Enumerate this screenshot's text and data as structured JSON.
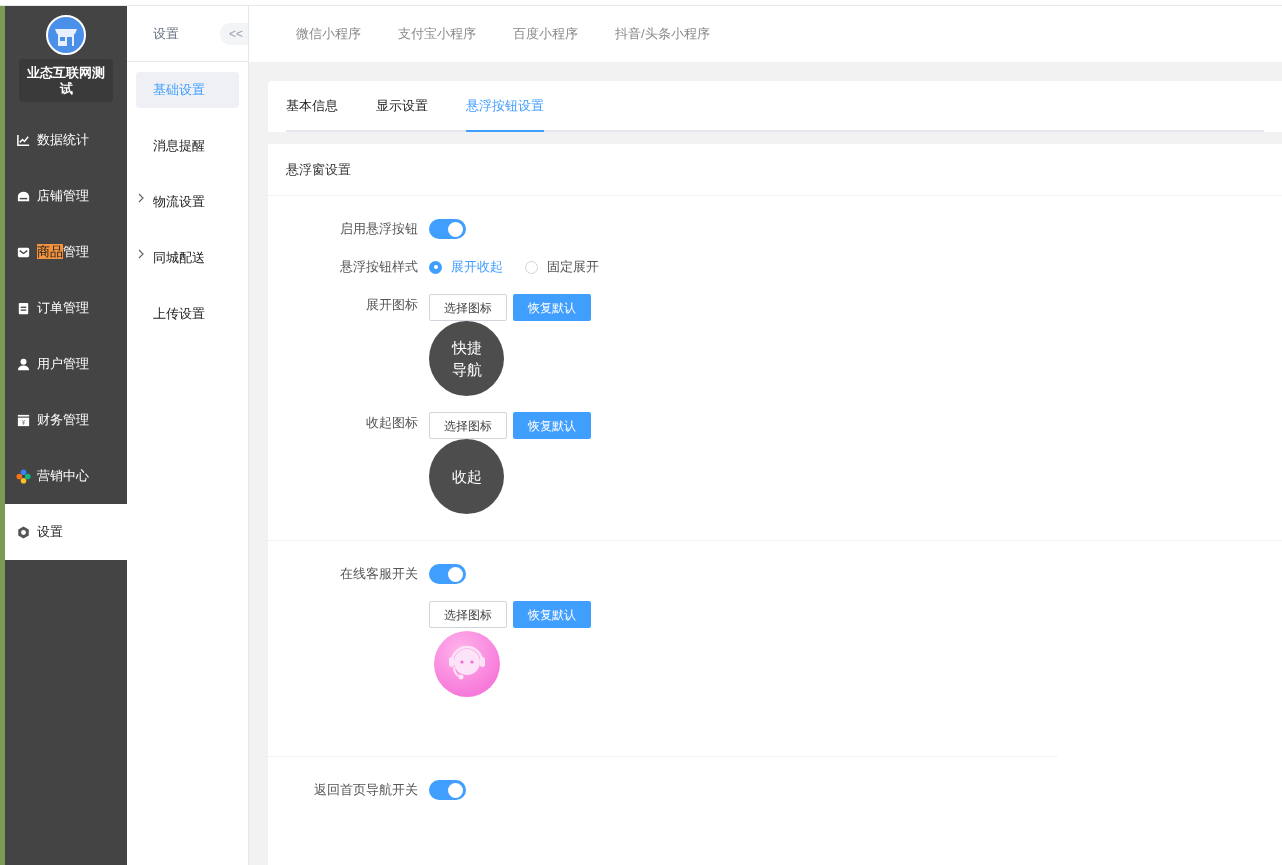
{
  "sidebar": {
    "store_name": "业态互联网测试",
    "items": [
      {
        "selected": false,
        "label_parts": [
          {
            "text": "数据统计",
            "highlighted": false
          }
        ]
      },
      {
        "selected": false,
        "label_parts": [
          {
            "text": "店铺管理",
            "highlighted": false
          }
        ]
      },
      {
        "selected": false,
        "label_parts": [
          {
            "text": "商品",
            "highlighted": true
          },
          {
            "text": "管理",
            "highlighted": false
          }
        ]
      },
      {
        "selected": false,
        "label_parts": [
          {
            "text": "订单管理",
            "highlighted": false
          }
        ]
      },
      {
        "selected": false,
        "label_parts": [
          {
            "text": "用户管理",
            "highlighted": false
          }
        ]
      },
      {
        "selected": false,
        "label_parts": [
          {
            "text": "财务管理",
            "highlighted": false
          }
        ]
      },
      {
        "selected": false,
        "label_parts": [
          {
            "text": "营销中心",
            "highlighted": false
          }
        ]
      },
      {
        "selected": true,
        "label_parts": [
          {
            "text": "设置",
            "highlighted": false
          }
        ]
      }
    ]
  },
  "submenu": {
    "title": "设置",
    "collapse": "<<",
    "items": [
      {
        "label": "基础设置",
        "selected": true,
        "expandable": false
      },
      {
        "label": "消息提醒",
        "selected": false,
        "expandable": false
      },
      {
        "label": "物流设置",
        "selected": false,
        "expandable": true
      },
      {
        "label": "同城配送",
        "selected": false,
        "expandable": true
      },
      {
        "label": "上传设置",
        "selected": false,
        "expandable": false
      }
    ]
  },
  "platform_tabs": [
    "微信小程序",
    "支付宝小程序",
    "百度小程序",
    "抖音/头条小程序"
  ],
  "tabs": [
    {
      "label": "基本信息",
      "selected": false
    },
    {
      "label": "显示设置",
      "selected": false
    },
    {
      "label": "悬浮按钮设置",
      "selected": true
    }
  ],
  "panel_title": "悬浮窗设置",
  "sections": [
    {
      "rows": [
        {
          "kind": "toggle",
          "label": "启用悬浮按钮",
          "on": true
        },
        {
          "kind": "radio",
          "label": "悬浮按钮样式",
          "options": [
            {
              "label": "展开收起",
              "selected": true
            },
            {
              "label": "固定展开",
              "selected": false
            }
          ]
        },
        {
          "kind": "icon",
          "label": "展开图标",
          "select": "选择图标",
          "reset": "恢复默认",
          "preview": {
            "kind": "text",
            "lines": [
              "快捷",
              "导航"
            ]
          }
        },
        {
          "kind": "icon",
          "label": "收起图标",
          "select": "选择图标",
          "reset": "恢复默认",
          "preview": {
            "kind": "text",
            "lines": [
              "收起"
            ]
          }
        }
      ]
    },
    {
      "rows": [
        {
          "kind": "toggle",
          "label": "在线客服开关",
          "on": true
        },
        {
          "kind": "icon",
          "select": "选择图标",
          "reset": "恢复默认",
          "preview": {
            "kind": "headset"
          }
        }
      ]
    },
    {
      "rows": [
        {
          "kind": "toggle",
          "label": "返回首页导航开关",
          "on": true
        }
      ]
    }
  ]
}
